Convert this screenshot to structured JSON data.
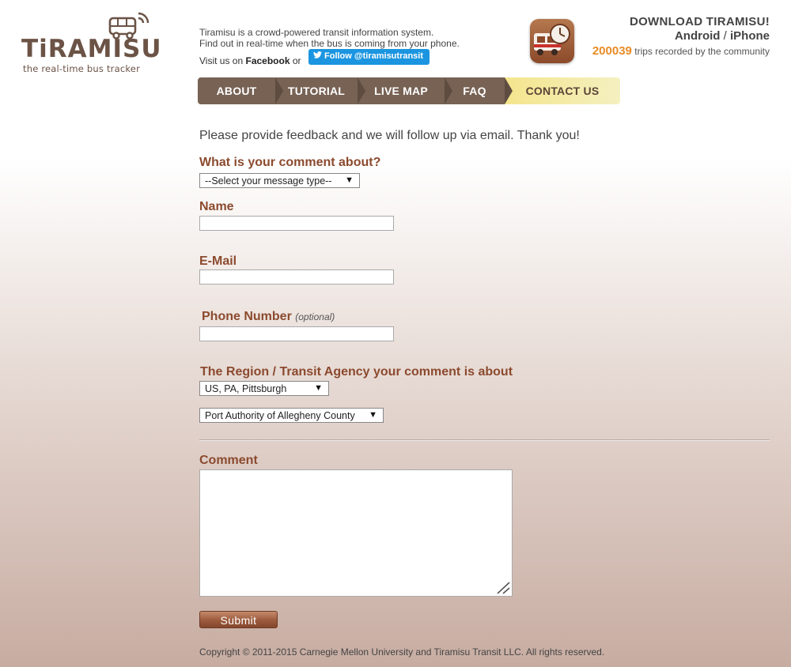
{
  "brand": {
    "name": "TiRAMISU",
    "tagline": "the real-time bus tracker"
  },
  "intro": {
    "line1": "Tiramisu is a crowd-powered transit information system.",
    "line2": "Find out in real-time when the bus is coming from your phone.",
    "visit_prefix": "Visit us on",
    "facebook": "Facebook",
    "or": "or",
    "twitter_follow": "Follow @tiramisutransit"
  },
  "download": {
    "title": "DOWNLOAD TIRAMISU!",
    "android": "Android",
    "separator": "/",
    "iphone": "iPhone",
    "trip_count": "200039",
    "trip_text": "trips recorded by the community"
  },
  "nav": {
    "tabs": [
      {
        "label": "ABOUT"
      },
      {
        "label": "TUTORIAL"
      },
      {
        "label": "LIVE MAP"
      },
      {
        "label": "FAQ"
      },
      {
        "label": "CONTACT US",
        "active": true
      }
    ]
  },
  "form": {
    "lead": "Please provide feedback and we will follow up via email. Thank you!",
    "comment_about_label": "What is your comment about?",
    "message_type_value": "--Select your message type--",
    "name_label": "Name",
    "name_value": "",
    "email_label": "E-Mail",
    "email_value": "",
    "phone_label": "Phone Number",
    "phone_optional": "(optional)",
    "phone_value": "",
    "region_label": "The Region / Transit Agency your comment is about",
    "region_value": "US, PA, Pittsburgh",
    "agency_value": "Port Authority of Allegheny County",
    "comment_label": "Comment",
    "comment_value": "",
    "submit_label": "Submit"
  },
  "footer": {
    "copyright": "Copyright © 2011-2015 Carnegie Mellon University and Tiramisu Transit LLC. All rights reserved."
  },
  "colors": {
    "brand_brown": "#6b5346",
    "label_rust": "#8b4a2e",
    "nav_brown": "#776254",
    "nav_active": "#f4e58d",
    "accent_orange": "#e88b26",
    "twitter_blue": "#1b95e0"
  },
  "icons": {
    "logo": "bus-with-signal-icon",
    "app": "tiramisu-app-icon",
    "twitter": "twitter-bird-icon",
    "dropdown": "dropdown-arrow-icon",
    "resize": "resize-grip-icon"
  }
}
